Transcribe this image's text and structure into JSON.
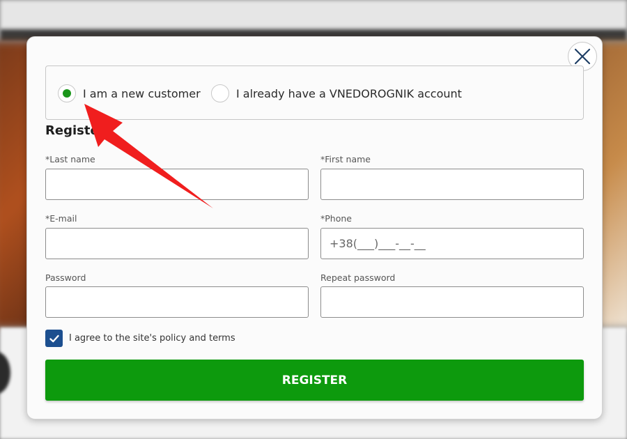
{
  "modal": {
    "close_icon": "close-icon",
    "customer_type": {
      "options": [
        {
          "label": "I am a new customer",
          "selected": true
        },
        {
          "label": "I already have a VNEDOROGNIK account",
          "selected": false
        }
      ]
    },
    "section_title": "Register",
    "fields": {
      "last_name": {
        "label": "*Last name",
        "value": ""
      },
      "first_name": {
        "label": "*First name",
        "value": ""
      },
      "email": {
        "label": "*E-mail",
        "value": ""
      },
      "phone": {
        "label": "*Phone",
        "placeholder": "+38(___)___-__-__"
      },
      "password": {
        "label": "Password",
        "value": ""
      },
      "repeat_password": {
        "label": "Repeat password",
        "value": ""
      }
    },
    "agree": {
      "label": "I agree to the site's policy and terms",
      "checked": true
    },
    "submit_label": "REGISTER"
  },
  "colors": {
    "accent_green": "#0d9a0d",
    "checkbox_blue": "#1c4f8f",
    "annotation_red": "#f01e1e"
  }
}
